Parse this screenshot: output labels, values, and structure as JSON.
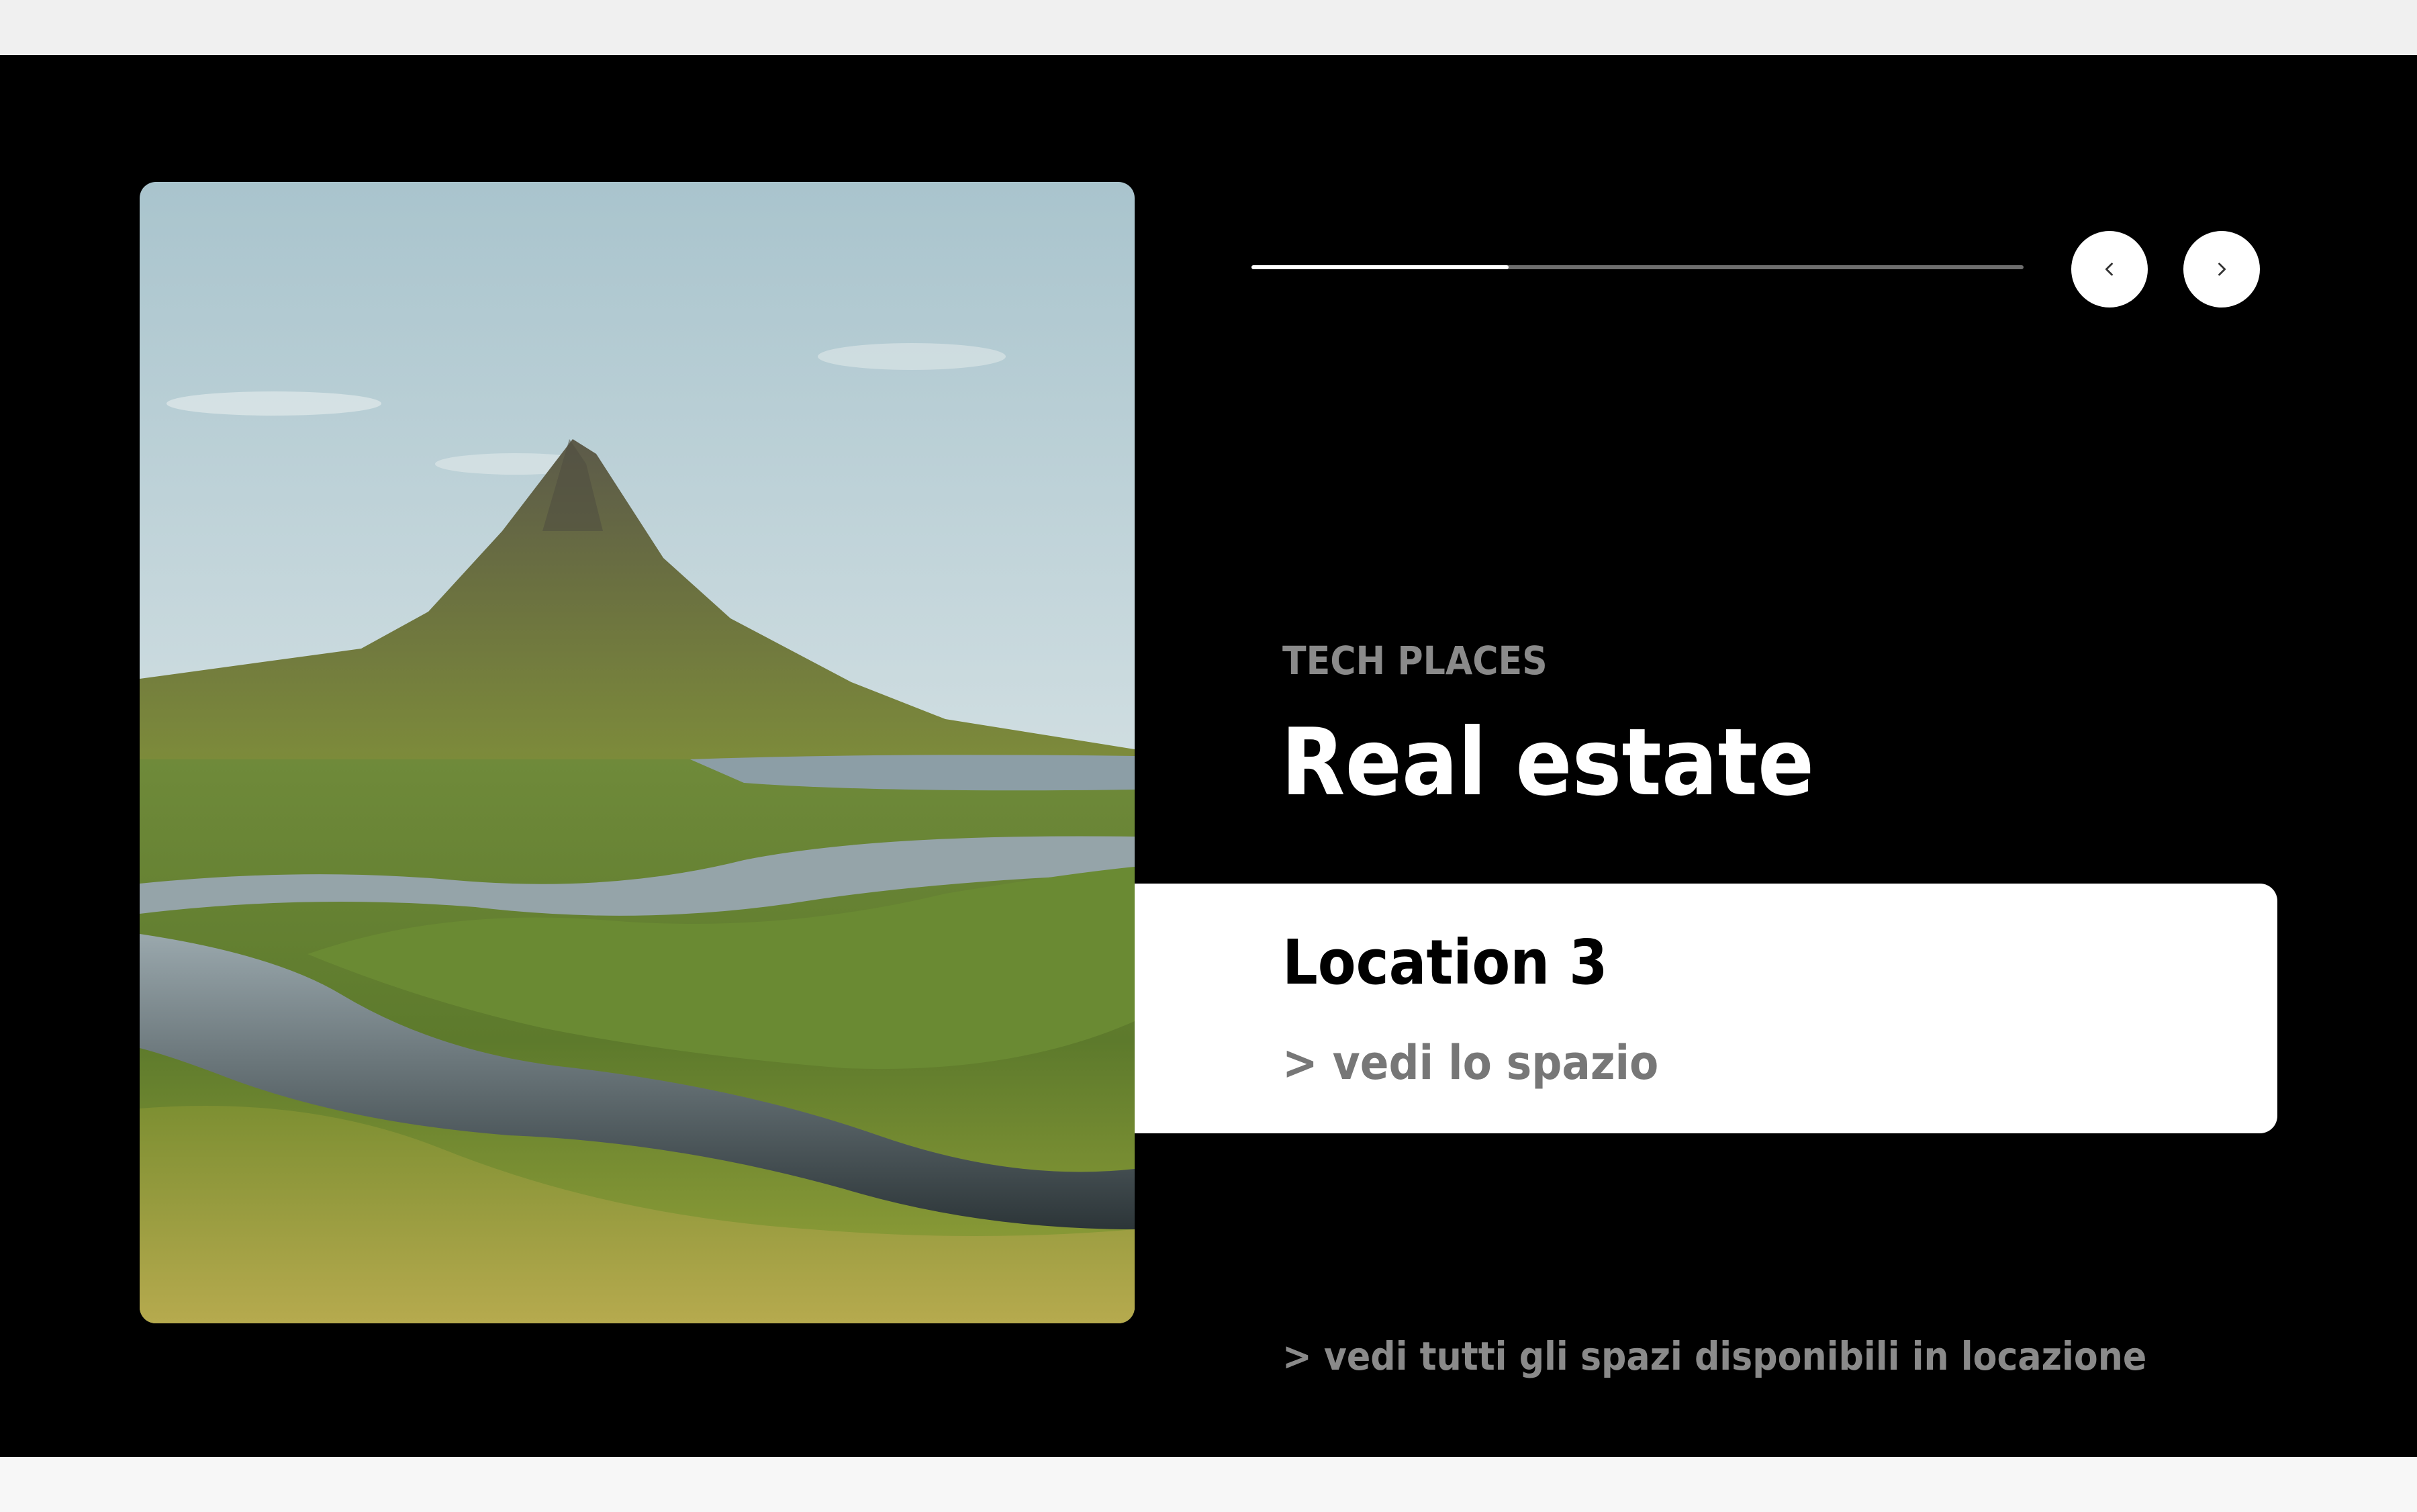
{
  "slider": {
    "progress_fraction": 0.333,
    "prev_icon": "chevron-left-icon",
    "next_icon": "chevron-right-icon"
  },
  "content": {
    "eyebrow": "TECH PLACES",
    "title": "Real estate",
    "location_name": "Location 3",
    "location_link": "> vedi lo spazio",
    "all_spaces_link": "> vedi tutti gli spazi disponibili in locazione"
  },
  "colors": {
    "hero_background": "#000000",
    "muted_text": "#8a8a8a",
    "card_background": "#ffffff"
  }
}
